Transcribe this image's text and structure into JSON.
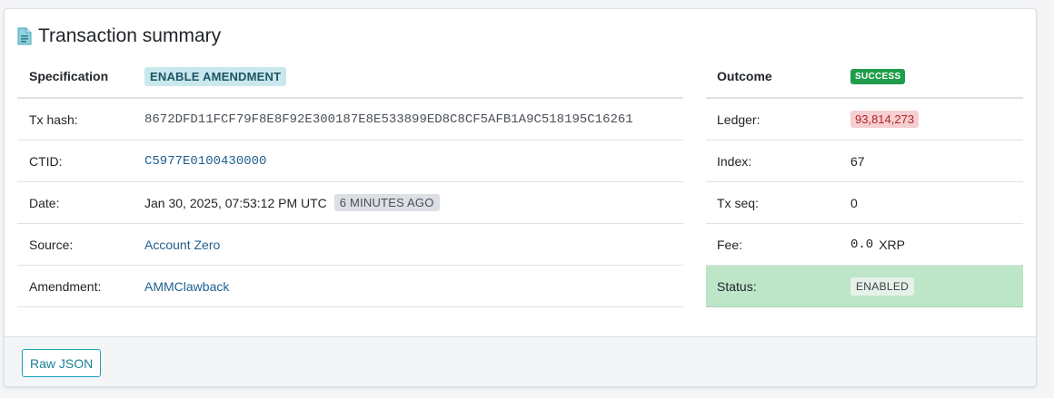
{
  "card": {
    "title": "Transaction summary",
    "icon": "document-icon"
  },
  "specification": {
    "header_label": "Specification",
    "type_badge": "ENABLE AMENDMENT",
    "rows": {
      "tx_hash_label": "Tx hash:",
      "tx_hash_value": "8672DFD11FCF79F8E8F92E300187E8E533899ED8C8CF5AFB1A9C518195C16261",
      "ctid_label": "CTID:",
      "ctid_value": "C5977E0100430000",
      "date_label": "Date:",
      "date_value": "Jan 30, 2025, 07:53:12 PM UTC",
      "date_ago": "6 MINUTES AGO",
      "source_label": "Source:",
      "source_value": "Account Zero",
      "amendment_label": "Amendment:",
      "amendment_value": "AMMClawback"
    }
  },
  "outcome": {
    "header_label": "Outcome",
    "result_badge": "SUCCESS",
    "rows": {
      "ledger_label": "Ledger:",
      "ledger_value": "93,814,273",
      "index_label": "Index:",
      "index_value": "67",
      "tx_seq_label": "Tx seq:",
      "tx_seq_value": "0",
      "fee_label": "Fee:",
      "fee_value": "0.0",
      "fee_currency": "XRP",
      "status_label": "Status:",
      "status_value": "ENABLED"
    }
  },
  "footer": {
    "raw_json_label": "Raw JSON"
  },
  "colors": {
    "success_green": "#1f9d4b",
    "status_row_bg": "#bde5c8",
    "ledger_badge_bg": "#f6cfd0",
    "type_badge_bg": "#c9e8ee",
    "link": "#1f5f8f",
    "accent_teal": "#17a2b8"
  }
}
